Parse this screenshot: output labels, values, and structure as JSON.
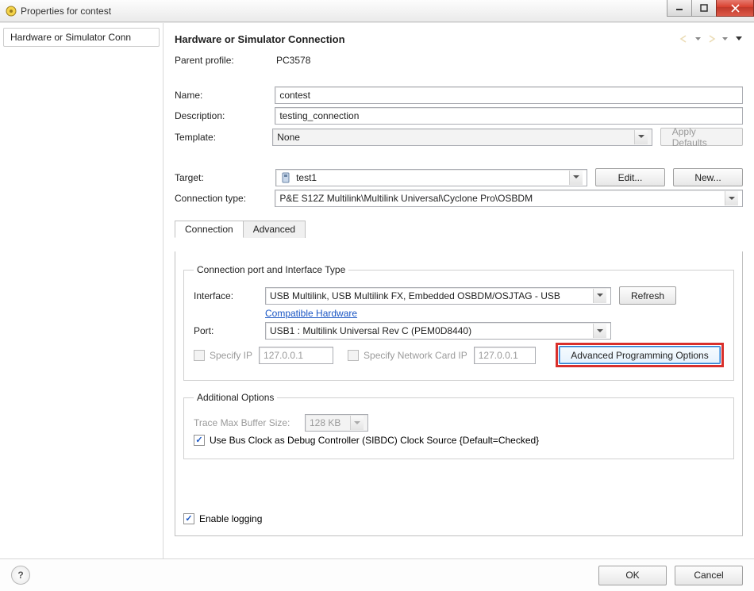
{
  "window": {
    "title": "Properties for contest"
  },
  "sidebar": {
    "items": [
      {
        "label": "Hardware or Simulator Conn"
      }
    ]
  },
  "header": {
    "title": "Hardware or Simulator Connection"
  },
  "profile": {
    "parent_label": "Parent profile:",
    "parent_value": "PC3578",
    "name_label": "Name:",
    "name_value": "contest",
    "description_label": "Description:",
    "description_value": "testing_connection",
    "template_label": "Template:",
    "template_value": "None",
    "apply_defaults": "Apply Defaults",
    "target_label": "Target:",
    "target_value": "test1",
    "edit": "Edit...",
    "new": "New...",
    "conn_type_label": "Connection type:",
    "conn_type_value": "P&E S12Z Multilink\\Multilink Universal\\Cyclone Pro\\OSBDM"
  },
  "tabs": {
    "connection": "Connection",
    "advanced": "Advanced"
  },
  "conn_port_group": {
    "legend": "Connection port and Interface Type",
    "interface_label": "Interface:",
    "interface_value": "USB Multilink, USB Multilink FX, Embedded OSBDM/OSJTAG - USB",
    "refresh": "Refresh",
    "compatible_hw": "Compatible Hardware",
    "port_label": "Port:",
    "port_value": "USB1 : Multilink Universal Rev C (PEM0D8440)",
    "specify_ip": "Specify IP",
    "ip_value": "127.0.0.1",
    "specify_nic": "Specify Network Card IP",
    "nic_value": "127.0.0.1",
    "adv_prog": "Advanced Programming Options"
  },
  "add_opts_group": {
    "legend": "Additional Options",
    "trace_label": "Trace Max Buffer Size:",
    "trace_value": "128 KB",
    "bus_clock": "Use Bus Clock as Debug Controller (SIBDC) Clock Source {Default=Checked}"
  },
  "enable_logging": "Enable logging",
  "footer": {
    "ok": "OK",
    "cancel": "Cancel"
  }
}
